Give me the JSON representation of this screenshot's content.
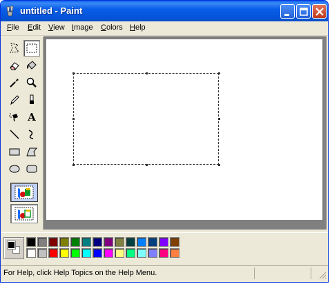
{
  "window": {
    "title": "untitled - Paint"
  },
  "menu": [
    "File",
    "Edit",
    "View",
    "Image",
    "Colors",
    "Help"
  ],
  "tools": [
    {
      "name": "free-form-select-icon",
      "selected": false
    },
    {
      "name": "rectangle-select-icon",
      "selected": true
    },
    {
      "name": "eraser-icon",
      "selected": false
    },
    {
      "name": "fill-bucket-icon",
      "selected": false
    },
    {
      "name": "pick-color-icon",
      "selected": false
    },
    {
      "name": "magnifier-icon",
      "selected": false
    },
    {
      "name": "pencil-icon",
      "selected": false
    },
    {
      "name": "brush-icon",
      "selected": false
    },
    {
      "name": "airbrush-icon",
      "selected": false
    },
    {
      "name": "text-icon",
      "selected": false
    },
    {
      "name": "line-icon",
      "selected": false
    },
    {
      "name": "curve-icon",
      "selected": false
    },
    {
      "name": "rectangle-icon",
      "selected": false
    },
    {
      "name": "polygon-icon",
      "selected": false
    },
    {
      "name": "ellipse-icon",
      "selected": false
    },
    {
      "name": "rounded-rectangle-icon",
      "selected": false
    }
  ],
  "text_tool_glyph": "A",
  "colors": {
    "foreground": "#000000",
    "background": "#ffffff",
    "palette_top": [
      "#000000",
      "#808080",
      "#800000",
      "#808000",
      "#008000",
      "#008080",
      "#000080",
      "#800080",
      "#808040",
      "#004040",
      "#0080ff",
      "#004080",
      "#8000ff",
      "#804000"
    ],
    "palette_bottom": [
      "#ffffff",
      "#c0c0c0",
      "#ff0000",
      "#ffff00",
      "#00ff00",
      "#00ffff",
      "#0000ff",
      "#ff00ff",
      "#ffff80",
      "#00ff80",
      "#80ffff",
      "#8080ff",
      "#ff0080",
      "#ff8040"
    ]
  },
  "status": {
    "help_text": "For Help, click Help Topics on the Help Menu."
  }
}
